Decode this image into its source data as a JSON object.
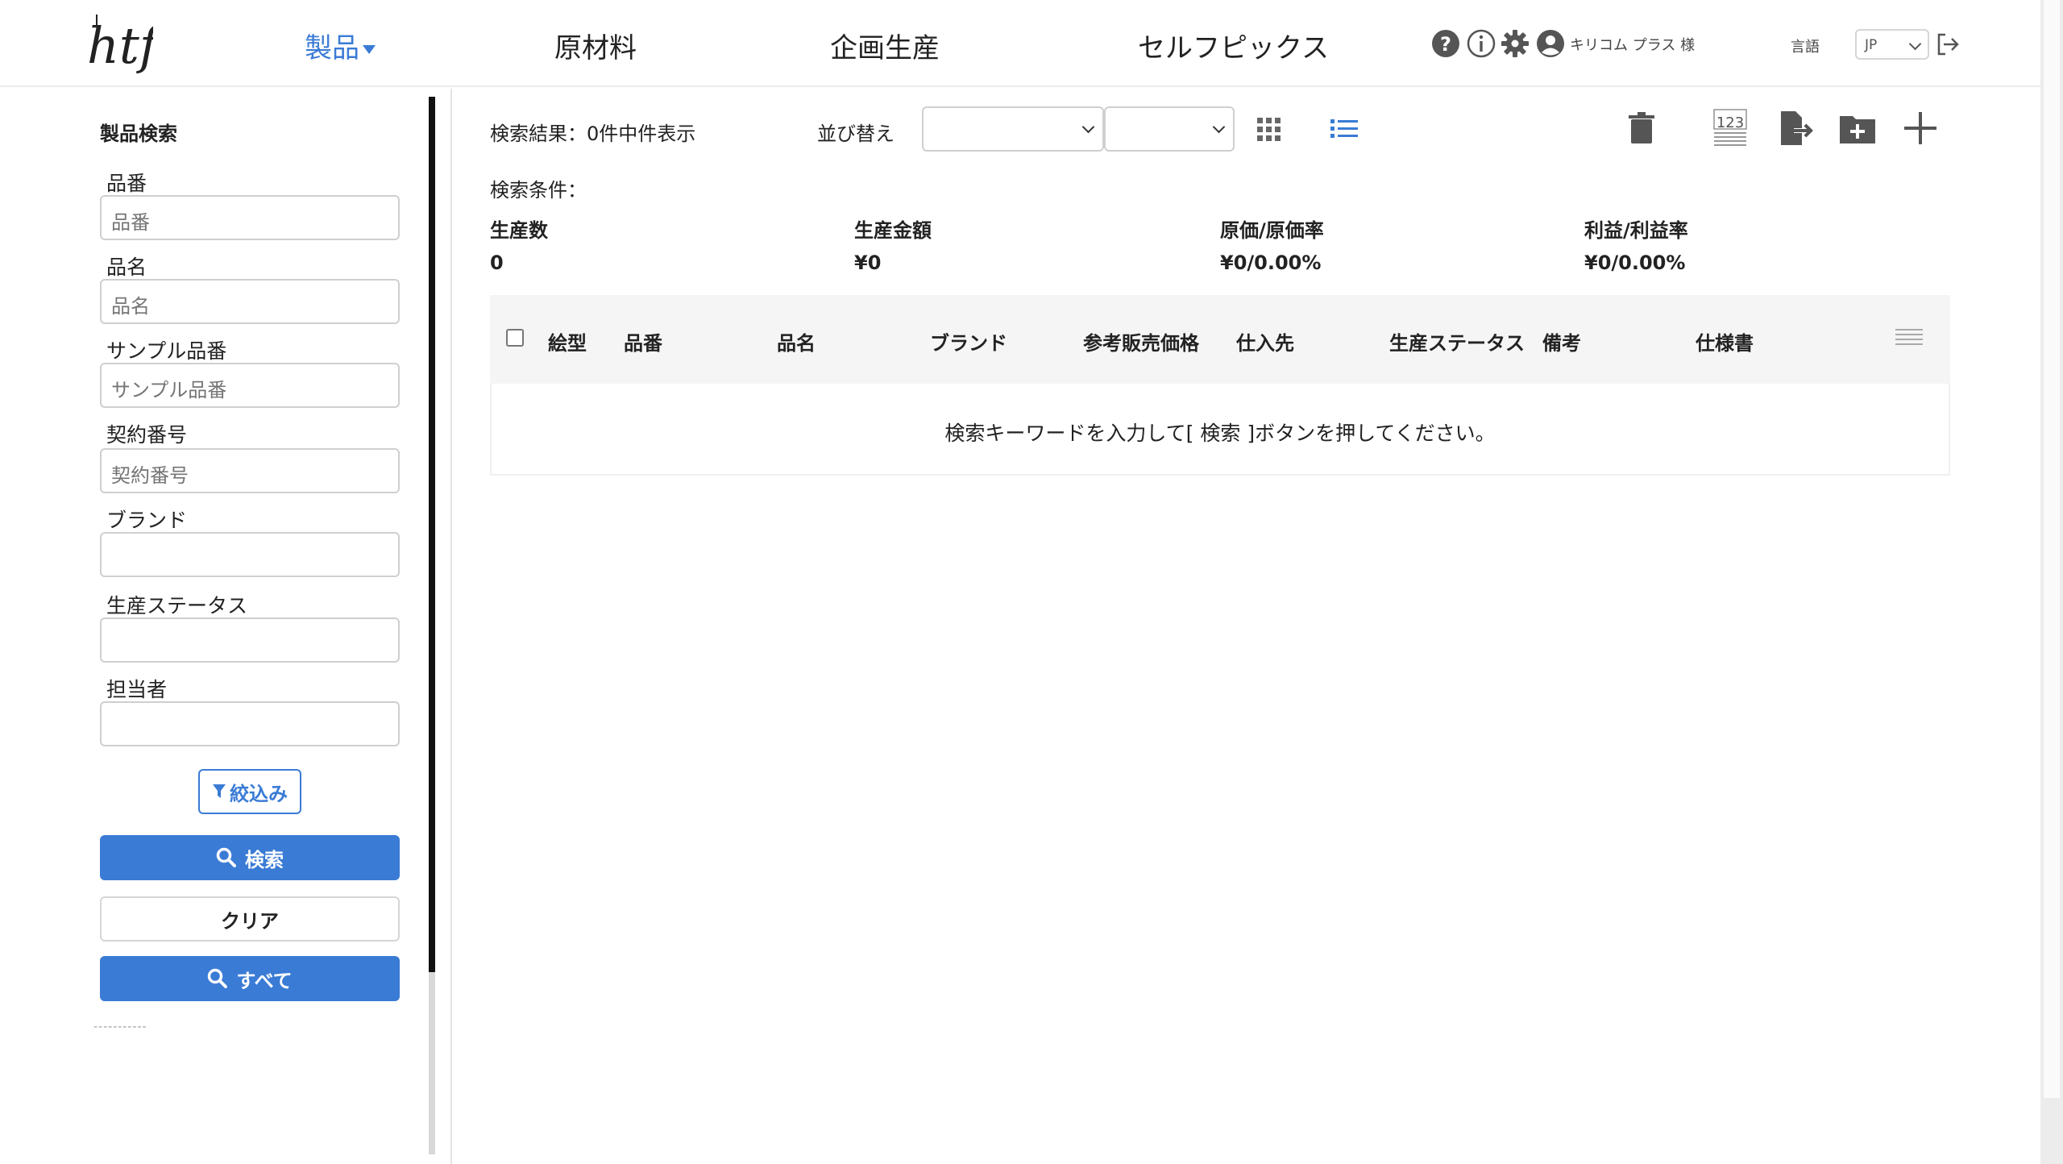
{
  "header": {
    "logo_text": "htf",
    "nav": [
      {
        "label": "製品"
      },
      {
        "label": "原材料"
      },
      {
        "label": "企画生産"
      },
      {
        "label": "セルフピックス"
      }
    ],
    "user_name": "キリコム プラス 様",
    "lang_label": "言語",
    "lang_value": "JP",
    "icons": [
      "help-icon",
      "info-icon",
      "settings-icon",
      "user-icon",
      "logout-icon"
    ],
    "accent_color": "#3a7bd5"
  },
  "sidebar": {
    "title": "製品検索",
    "fields": [
      {
        "label": "品番",
        "placeholder": "品番"
      },
      {
        "label": "品名",
        "placeholder": "品名"
      },
      {
        "label": "サンプル品番",
        "placeholder": "サンプル品番"
      },
      {
        "label": "契約番号",
        "placeholder": "契約番号"
      },
      {
        "label": "ブランド",
        "placeholder": ""
      },
      {
        "label": "生産ステータス",
        "placeholder": ""
      },
      {
        "label": "担当者",
        "placeholder": ""
      }
    ],
    "filter_label": "絞込み",
    "search_label": "検索",
    "clear_label": "クリア",
    "all_label": "すべて",
    "divider_text": "-----------"
  },
  "main": {
    "result_text": "検索結果：0件中件表示",
    "sort_label": "並び替え",
    "condition_label": "検索条件：",
    "summary": [
      {
        "label": "生産数",
        "value": "0"
      },
      {
        "label": "生産金額",
        "value": "¥0"
      },
      {
        "label": "原価/原価率",
        "value": "¥0/0.00%"
      },
      {
        "label": "利益/利益率",
        "value": "¥0/0.00%"
      }
    ],
    "columns": [
      "絵型",
      "品番",
      "品名",
      "ブランド",
      "参考販売価格",
      "仕入先",
      "生産ステータス",
      "備考",
      "仕様書"
    ],
    "empty_message": "検索キーワードを入力して[ 検索 ]ボタンを押してください。",
    "toolbar_icons": [
      "grid-view-icon",
      "list-view-icon",
      "trash-icon",
      "numbering-icon",
      "export-icon",
      "add-folder-icon",
      "plus-icon"
    ]
  }
}
